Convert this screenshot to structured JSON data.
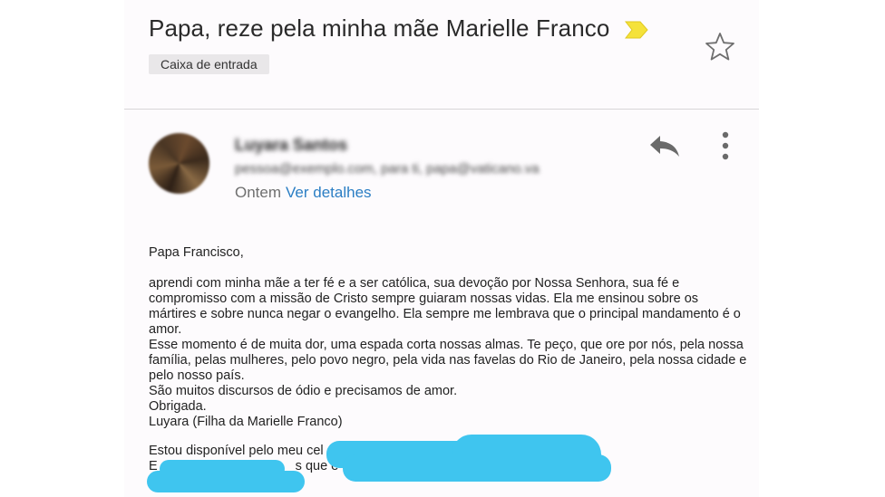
{
  "header": {
    "subject": "Papa, reze pela minha mãe Marielle Franco",
    "label": "Caixa de entrada"
  },
  "sender": {
    "name": "Luyara Santos",
    "email": "pessoa@exemplo.com, para ti, papa@vaticano.va",
    "when": "Ontem",
    "details_link": "Ver detalhes"
  },
  "message": {
    "greeting": "Papa Francisco,",
    "paragraph1": "aprendi com minha mãe a ter fé e a ser católica, sua devoção por Nossa Senhora, sua fé e compromisso com a missão de Cristo sempre guiaram nossas vidas. Ela me ensinou sobre os mártires e sobre nunca negar o evangelho. Ela sempre me lembrava que o principal mandamento é o amor.",
    "paragraph2": "Esse momento é de muita dor, uma espada corta nossas almas. Te peço, que ore por nós, pela nossa família, pelas mulheres, pelo povo negro, pela vida nas favelas do Rio de Janeiro, pela nossa cidade e pelo nosso país.",
    "line3": "São muitos discursos de ódio e precisamos de amor.",
    "line4": "Obrigada.",
    "signature": "Luyara (Filha da Marielle Franco)",
    "contact_line1": "Estou disponível pelo meu cel",
    "contact_line2_start": "E",
    "contact_line2_mid": "s que e"
  },
  "icons": {
    "important": "important-marker-icon",
    "star": "star-icon",
    "reply": "reply-icon",
    "more": "more-vert-icon"
  },
  "colors": {
    "link": "#2b7ec4",
    "important": "#f5e23a",
    "redaction": "#3fc5ef"
  }
}
